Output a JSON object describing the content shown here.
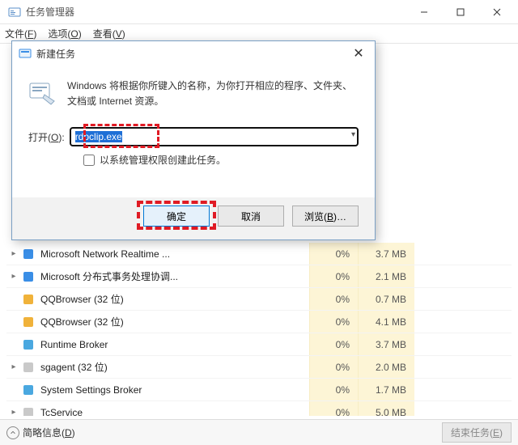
{
  "window": {
    "title": "任务管理器",
    "buttons": {
      "min": "—",
      "max": "☐",
      "close": "✕"
    }
  },
  "menu": {
    "file": "文件(F)",
    "options": "选项(O)",
    "view": "查看(V)"
  },
  "dialog": {
    "title": "新建任务",
    "desc": "Windows 将根据你所键入的名称，为你打开相应的程序、文件夹、文档或 Internet 资源。",
    "open_label": "打开(O):",
    "input_value": "rdpclip.exe",
    "admin_label": "以系统管理权限创建此任务。",
    "ok": "确定",
    "cancel": "取消",
    "browse": "浏览(B)…"
  },
  "processes": [
    {
      "expand": true,
      "iconColor": "#3a8ee6",
      "name": "Microsoft Network Realtime ...",
      "cpu": "0%",
      "mem": "3.7 MB"
    },
    {
      "expand": true,
      "iconColor": "#3a8ee6",
      "name": "Microsoft 分布式事务处理协调...",
      "cpu": "0%",
      "mem": "2.1 MB"
    },
    {
      "expand": false,
      "iconColor": "#f0b23a",
      "name": "QQBrowser (32 位)",
      "cpu": "0%",
      "mem": "0.7 MB"
    },
    {
      "expand": false,
      "iconColor": "#f0b23a",
      "name": "QQBrowser (32 位)",
      "cpu": "0%",
      "mem": "4.1 MB"
    },
    {
      "expand": false,
      "iconColor": "#4aa8e0",
      "name": "Runtime Broker",
      "cpu": "0%",
      "mem": "3.7 MB"
    },
    {
      "expand": true,
      "iconColor": "#c9c9c9",
      "name": "sgagent (32 位)",
      "cpu": "0%",
      "mem": "2.0 MB"
    },
    {
      "expand": false,
      "iconColor": "#4aa8e0",
      "name": "System Settings Broker",
      "cpu": "0%",
      "mem": "1.7 MB"
    },
    {
      "expand": true,
      "iconColor": "#c9c9c9",
      "name": "TcService",
      "cpu": "0%",
      "mem": "5.0 MB"
    }
  ],
  "statusbar": {
    "collapse": "简略信息(D)",
    "endtask": "结束任务(E)"
  }
}
